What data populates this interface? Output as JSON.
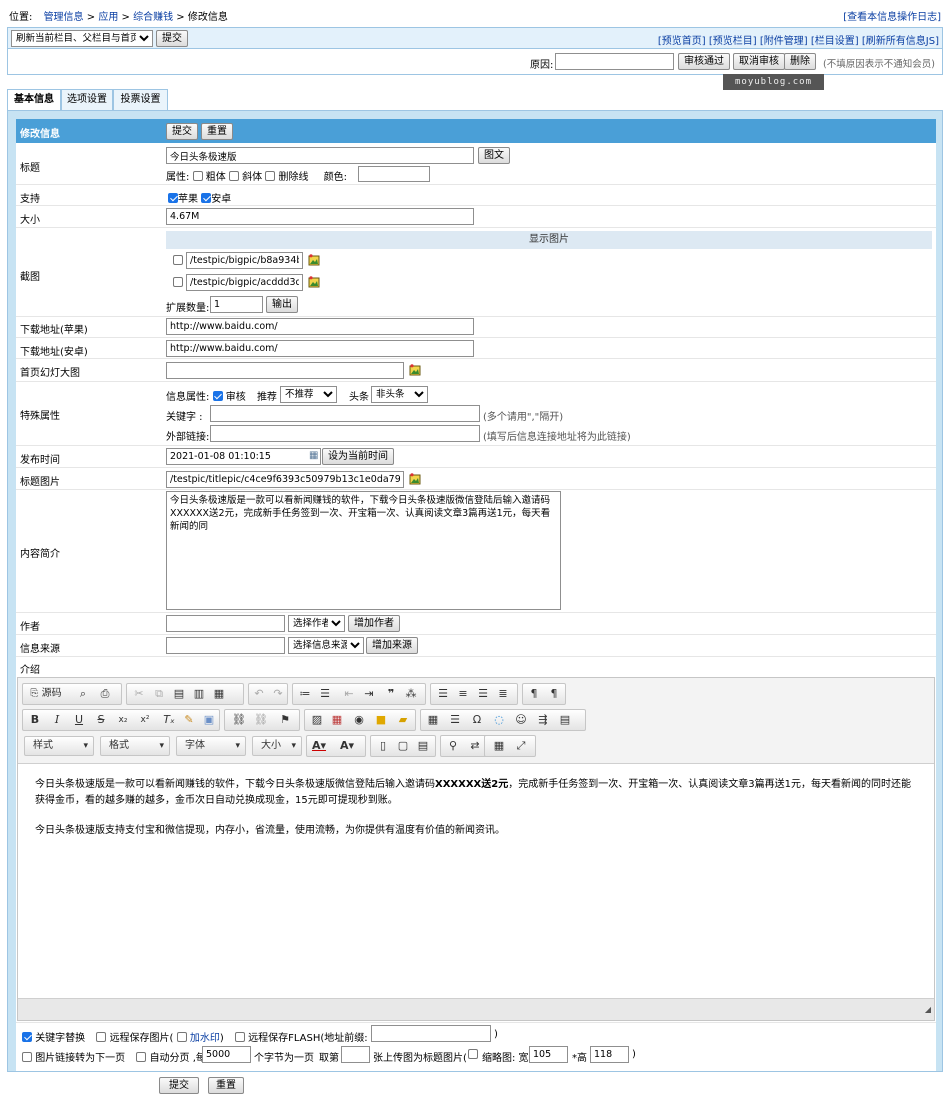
{
  "breadcrumb": {
    "prefix": "位置:",
    "items": [
      "管理信息",
      "应用",
      "综合赚钱",
      "修改信息"
    ],
    "sep": ">",
    "log_link": "[查看本信息操作日志]"
  },
  "toolbar1": {
    "refresh_select": "刷新当前栏目、父栏目与首页",
    "submit": "提交",
    "links": [
      "[预览首页]",
      "[预览栏目]",
      "[附件管理]",
      "[栏目设置]",
      "[刷新所有信息JS]"
    ]
  },
  "toolbar2": {
    "reason_label": "原因:",
    "reason_value": "",
    "approve": "审核通过",
    "cancel_approve": "取消审核",
    "delete": "删除",
    "hint": "(不填原因表示不通知会员)"
  },
  "watermark": "moyublog.com",
  "tabs": [
    "基本信息",
    "选项设置",
    "投票设置"
  ],
  "form": {
    "header_label": "修改信息",
    "submit": "提交",
    "reset": "重置",
    "title": {
      "label": "标题",
      "value": "今日头条极速版",
      "btn": "图文",
      "attr_label": "属性:",
      "bold": "粗体",
      "italic": "斜体",
      "strike": "删除线",
      "color_label": "颜色:",
      "color_value": ""
    },
    "support": {
      "label": "支持",
      "opt1": "苹果",
      "opt2": "安卓"
    },
    "size": {
      "label": "大小",
      "value": "4.67M"
    },
    "screenshot": {
      "label": "截图",
      "header": "显示图片",
      "path1": "/testpic/bigpic/b8a934ba59",
      "path2": "/testpic/bigpic/acddd3d7dc",
      "expand_label": "扩展数量:",
      "expand_value": "1",
      "output": "输出"
    },
    "dl_apple": {
      "label": "下载地址(苹果)",
      "value": "http://www.baidu.com/"
    },
    "dl_android": {
      "label": "下载地址(安卓)",
      "value": "http://www.baidu.com/"
    },
    "slide": {
      "label": "首页幻灯大图",
      "value": ""
    },
    "special": {
      "label": "特殊属性",
      "info_attr": "信息属性:",
      "audit": "审核",
      "recommend_label": "推荐",
      "recommend_value": "不推荐",
      "headline_label": "头条",
      "headline_value": "非头条",
      "keyword_label": "关键字 :",
      "keyword_hint": "(多个请用\",\"隔开)",
      "link_label": "外部链接:",
      "link_hint": "(填写后信息连接地址将为此链接)"
    },
    "pubtime": {
      "label": "发布时间",
      "value": "2021-01-08 01:10:15",
      "btn": "设为当前时间"
    },
    "titlepic": {
      "label": "标题图片",
      "value": "/testpic/titlepic/c4ce9f6393c50979b13c1e0da796ab39.p"
    },
    "intro": {
      "label": "内容简介",
      "value": "今日头条极速版是一款可以看新闻赚钱的软件，下载今日头条极速版微信登陆后输入邀请码XXXXXX送2元，完成新手任务签到一次、开宝箱一次、认真阅读文章3篇再送1元，每天看新闻的同"
    },
    "author": {
      "label": "作者",
      "select": "选择作者",
      "add": "增加作者"
    },
    "source": {
      "label": "信息来源",
      "select": "选择信息来源",
      "add": "增加来源"
    },
    "content_label": "介绍"
  },
  "editor": {
    "source_btn": "源码",
    "combos": [
      "样式",
      "格式",
      "字体",
      "大小"
    ],
    "para1_a": "今日头条极速版是一款可以看新闻赚钱的软件，下载今日头条极速版微信登陆后输入邀请码",
    "para1_bold": "XXXXXX送2元",
    "para1_b": "，完成新手任务签到一次、开宝箱一次、认真阅读文章3篇再送1元，每天看新闻的同时还能获得金币，看的越多赚的越多，金币次日自动兑换成现金，15元即可提现秒到账。",
    "para2": "今日头条极速版支持支付宝和微信提现，内存小，省流量，使用流畅，为你提供有温度有价值的新闻资讯。"
  },
  "options": {
    "keyword_replace": "关键字替换",
    "remote_save": "远程保存图片(",
    "watermark_label": "加水印",
    "close_paren": ")",
    "remote_flash": "远程保存FLASH(地址前缀:",
    "flash_close": ")",
    "img_link": "图片链接转为下一页",
    "auto_page": "自动分页 ,每",
    "page_size": "5000",
    "page_unit": "个字节为一页",
    "take_label": "取第",
    "take_value": "",
    "title_pic_label": "张上传图为标题图片(",
    "thumb_label": "缩略图: 宽",
    "width": "105",
    "height_label": "*高",
    "height": "118",
    "end": ")"
  },
  "bottom": {
    "submit": "提交",
    "reset": "重置"
  }
}
